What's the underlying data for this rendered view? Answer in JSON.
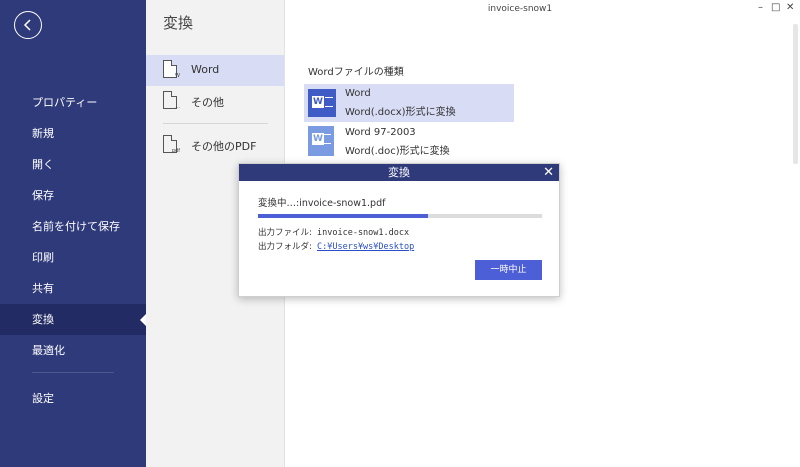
{
  "window": {
    "title": "invoice-snow1",
    "minimize": "–",
    "maximize": "□",
    "close": "✕"
  },
  "sidebar": {
    "items": [
      {
        "label": "プロパティー"
      },
      {
        "label": "新規"
      },
      {
        "label": "開く"
      },
      {
        "label": "保存"
      },
      {
        "label": "名前を付けて保存"
      },
      {
        "label": "印刷"
      },
      {
        "label": "共有"
      },
      {
        "label": "変換",
        "active": true
      },
      {
        "label": "最適化"
      }
    ],
    "settings_label": "設定"
  },
  "mid": {
    "title": "変換",
    "items": [
      {
        "label": "Word",
        "tag": "W"
      },
      {
        "label": "その他",
        "tag": "..."
      },
      {
        "label": "その他のPDF",
        "tag": "pdf"
      }
    ]
  },
  "content": {
    "section_title": "Wordファイルの種類",
    "options": [
      {
        "name": "Word",
        "desc": "Word(.docx)形式に変換"
      },
      {
        "name": "Word 97-2003",
        "desc": "Word(.doc)形式に変換"
      }
    ]
  },
  "dialog": {
    "title": "変換",
    "close": "✕",
    "status": "変換中…:invoice-snow1.pdf",
    "progress_percent": 60,
    "output_file_label": "出力ファイル:",
    "output_file_value": "invoice-snow1.docx",
    "output_folder_label": "出力フォルダ:",
    "output_folder_value": "C:¥Users¥ws¥Desktop",
    "pause_label": "一時中止"
  },
  "colors": {
    "sidebar_bg": "#2f3a7a",
    "sidebar_active": "#222b63",
    "selection": "#d8dcf5",
    "accent": "#4c5fd6"
  }
}
